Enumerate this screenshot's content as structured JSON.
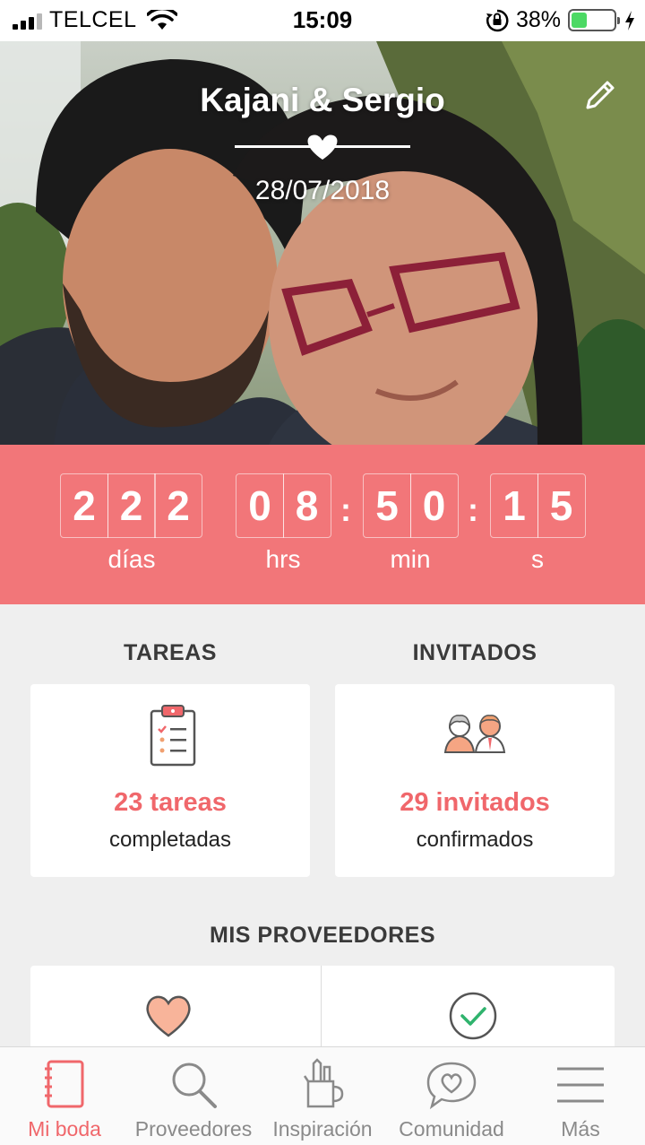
{
  "status_bar": {
    "carrier": "TELCEL",
    "time": "15:09",
    "battery_pct": "38%",
    "battery_level": 0.38,
    "icons": [
      "signal-icon",
      "wifi-icon",
      "rotation-lock-icon",
      "battery-icon",
      "charging-bolt-icon"
    ]
  },
  "hero": {
    "couple_names": "Kajani & Sergio",
    "wedding_date": "28/07/2018",
    "edit_icon": "pencil-icon"
  },
  "countdown": {
    "days": [
      "2",
      "2",
      "2"
    ],
    "hours": [
      "0",
      "8"
    ],
    "minutes": [
      "5",
      "0"
    ],
    "seconds": [
      "1",
      "5"
    ],
    "labels": {
      "days": "días",
      "hours": "hrs",
      "minutes": "min",
      "seconds": "s"
    }
  },
  "tasks": {
    "title": "TAREAS",
    "count": "23 tareas",
    "sub": "completadas",
    "icon": "clipboard-checklist-icon"
  },
  "guests": {
    "title": "INVITADOS",
    "count": "29 invitados",
    "sub": "confirmados",
    "icon": "couple-icon"
  },
  "vendors": {
    "title": "MIS PROVEEDORES",
    "icons": [
      "heart-icon",
      "checkmark-circle-icon"
    ]
  },
  "tab_bar": {
    "active": "Mi boda",
    "accent": "#f0676b",
    "tabs": [
      {
        "label": "Mi boda",
        "icon": "notebook-icon"
      },
      {
        "label": "Proveedores",
        "icon": "search-icon"
      },
      {
        "label": "Inspiración",
        "icon": "pencil-cup-icon"
      },
      {
        "label": "Comunidad",
        "icon": "heart-chat-icon"
      },
      {
        "label": "Más",
        "icon": "menu-icon"
      }
    ]
  },
  "colors": {
    "accent": "#f27679",
    "background": "#efefef",
    "battery": "#4cd964"
  }
}
